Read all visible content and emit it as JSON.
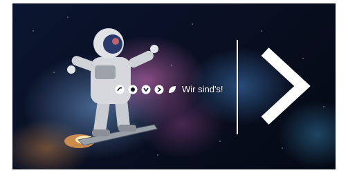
{
  "banner": {
    "tagline": "Wir sind's!",
    "logos": [
      "brand-logo-1-icon",
      "brand-logo-2-icon",
      "brand-logo-3-icon",
      "brand-logo-4-icon",
      "brand-logo-5-icon"
    ],
    "next_icon": "chevron-right-icon",
    "colors": {
      "text": "#ffffff",
      "space_dark": "#0a1024",
      "nebula_pink": "#e678c8",
      "nebula_blue": "#78aae6"
    }
  }
}
